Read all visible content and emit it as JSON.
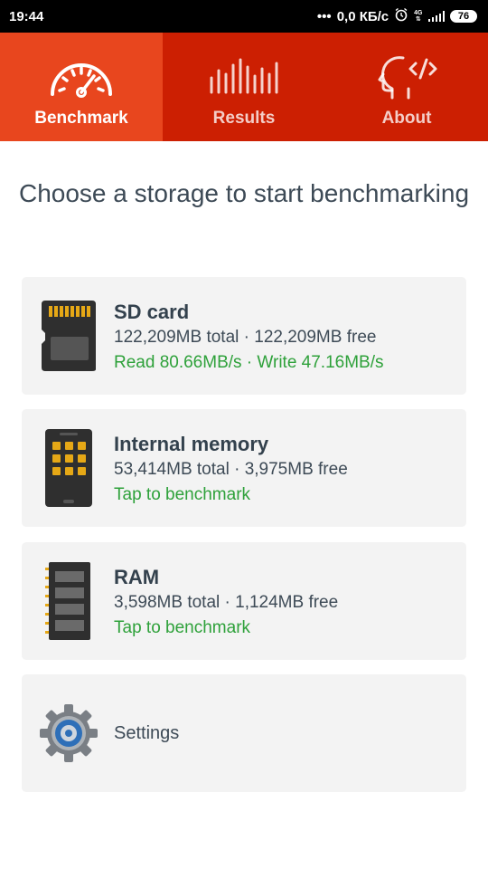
{
  "status_bar": {
    "time": "19:44",
    "network_speed": "0,0 КБ/с",
    "network_type": "4G",
    "battery": "76"
  },
  "tabs": [
    {
      "label": "Benchmark",
      "icon": "speedometer-icon",
      "active": true
    },
    {
      "label": "Results",
      "icon": "bar-chart-icon",
      "active": false
    },
    {
      "label": "About",
      "icon": "head-code-icon",
      "active": false
    }
  ],
  "heading": "Choose a storage to start benchmarking",
  "storages": [
    {
      "name": "SD card",
      "info": "122,209MB total · 122,209MB free",
      "status": "Read 80.66MB/s · Write 47.16MB/s",
      "icon": "sd-card-icon"
    },
    {
      "name": "Internal memory",
      "info": "53,414MB total · 3,975MB free",
      "status": "Tap to benchmark",
      "icon": "phone-memory-icon"
    },
    {
      "name": "RAM",
      "info": "3,598MB total · 1,124MB free",
      "status": "Tap to benchmark",
      "icon": "ram-chip-icon"
    }
  ],
  "settings": {
    "label": "Settings",
    "icon": "gear-icon"
  },
  "colors": {
    "tab_bar": "#cc1f02",
    "tab_active": "#e8461e",
    "status_green": "#2ea13a",
    "card_bg": "#f3f3f3",
    "text_dark": "#3d4a56"
  }
}
